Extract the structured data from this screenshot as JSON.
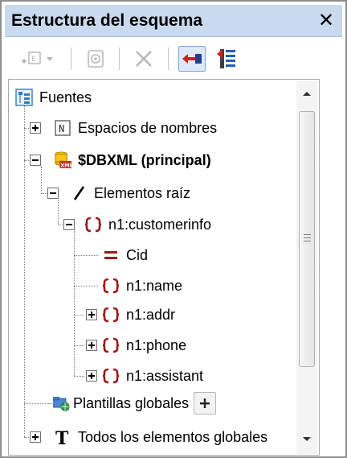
{
  "panel": {
    "title": "Estructura del esquema",
    "close_glyph": "✕"
  },
  "toolbar": {
    "buttons": [
      {
        "name": "add-element-icon",
        "enabled": false
      },
      {
        "name": "schema-properties-icon",
        "enabled": false
      },
      {
        "name": "delete-icon",
        "enabled": false
      },
      {
        "name": "show-tree-icon",
        "enabled": true,
        "active": true
      },
      {
        "name": "sort-icon",
        "enabled": true
      }
    ]
  },
  "tree": {
    "root": {
      "label": "Fuentes",
      "icon": "sources-icon"
    },
    "namespaces": {
      "label": "Espacios de nombres",
      "icon_letter": "N"
    },
    "dbxml": {
      "label": "$DBXML (principal)",
      "icon_tag": "XML"
    },
    "root_elements": {
      "label": "Elementos raíz"
    },
    "customerinfo": {
      "label": "n1:customerinfo"
    },
    "children": [
      {
        "label": "Cid",
        "icon": "attribute-icon",
        "expandable": false
      },
      {
        "label": "n1:name",
        "icon": "element-icon",
        "expandable": false
      },
      {
        "label": "n1:addr",
        "icon": "element-icon",
        "expandable": true
      },
      {
        "label": "n1:phone",
        "icon": "element-icon",
        "expandable": true
      },
      {
        "label": "n1:assistant",
        "icon": "element-icon",
        "expandable": true
      }
    ],
    "global_templates": {
      "label": "Plantillas globales",
      "add_glyph": "+"
    },
    "all_globals": {
      "label": "Todos los elementos globales",
      "icon_letter": "T"
    }
  },
  "colors": {
    "titlebar": "#c9d9ee",
    "element_icon": "#9b1c1c",
    "active_button": "#dbe9fb"
  }
}
